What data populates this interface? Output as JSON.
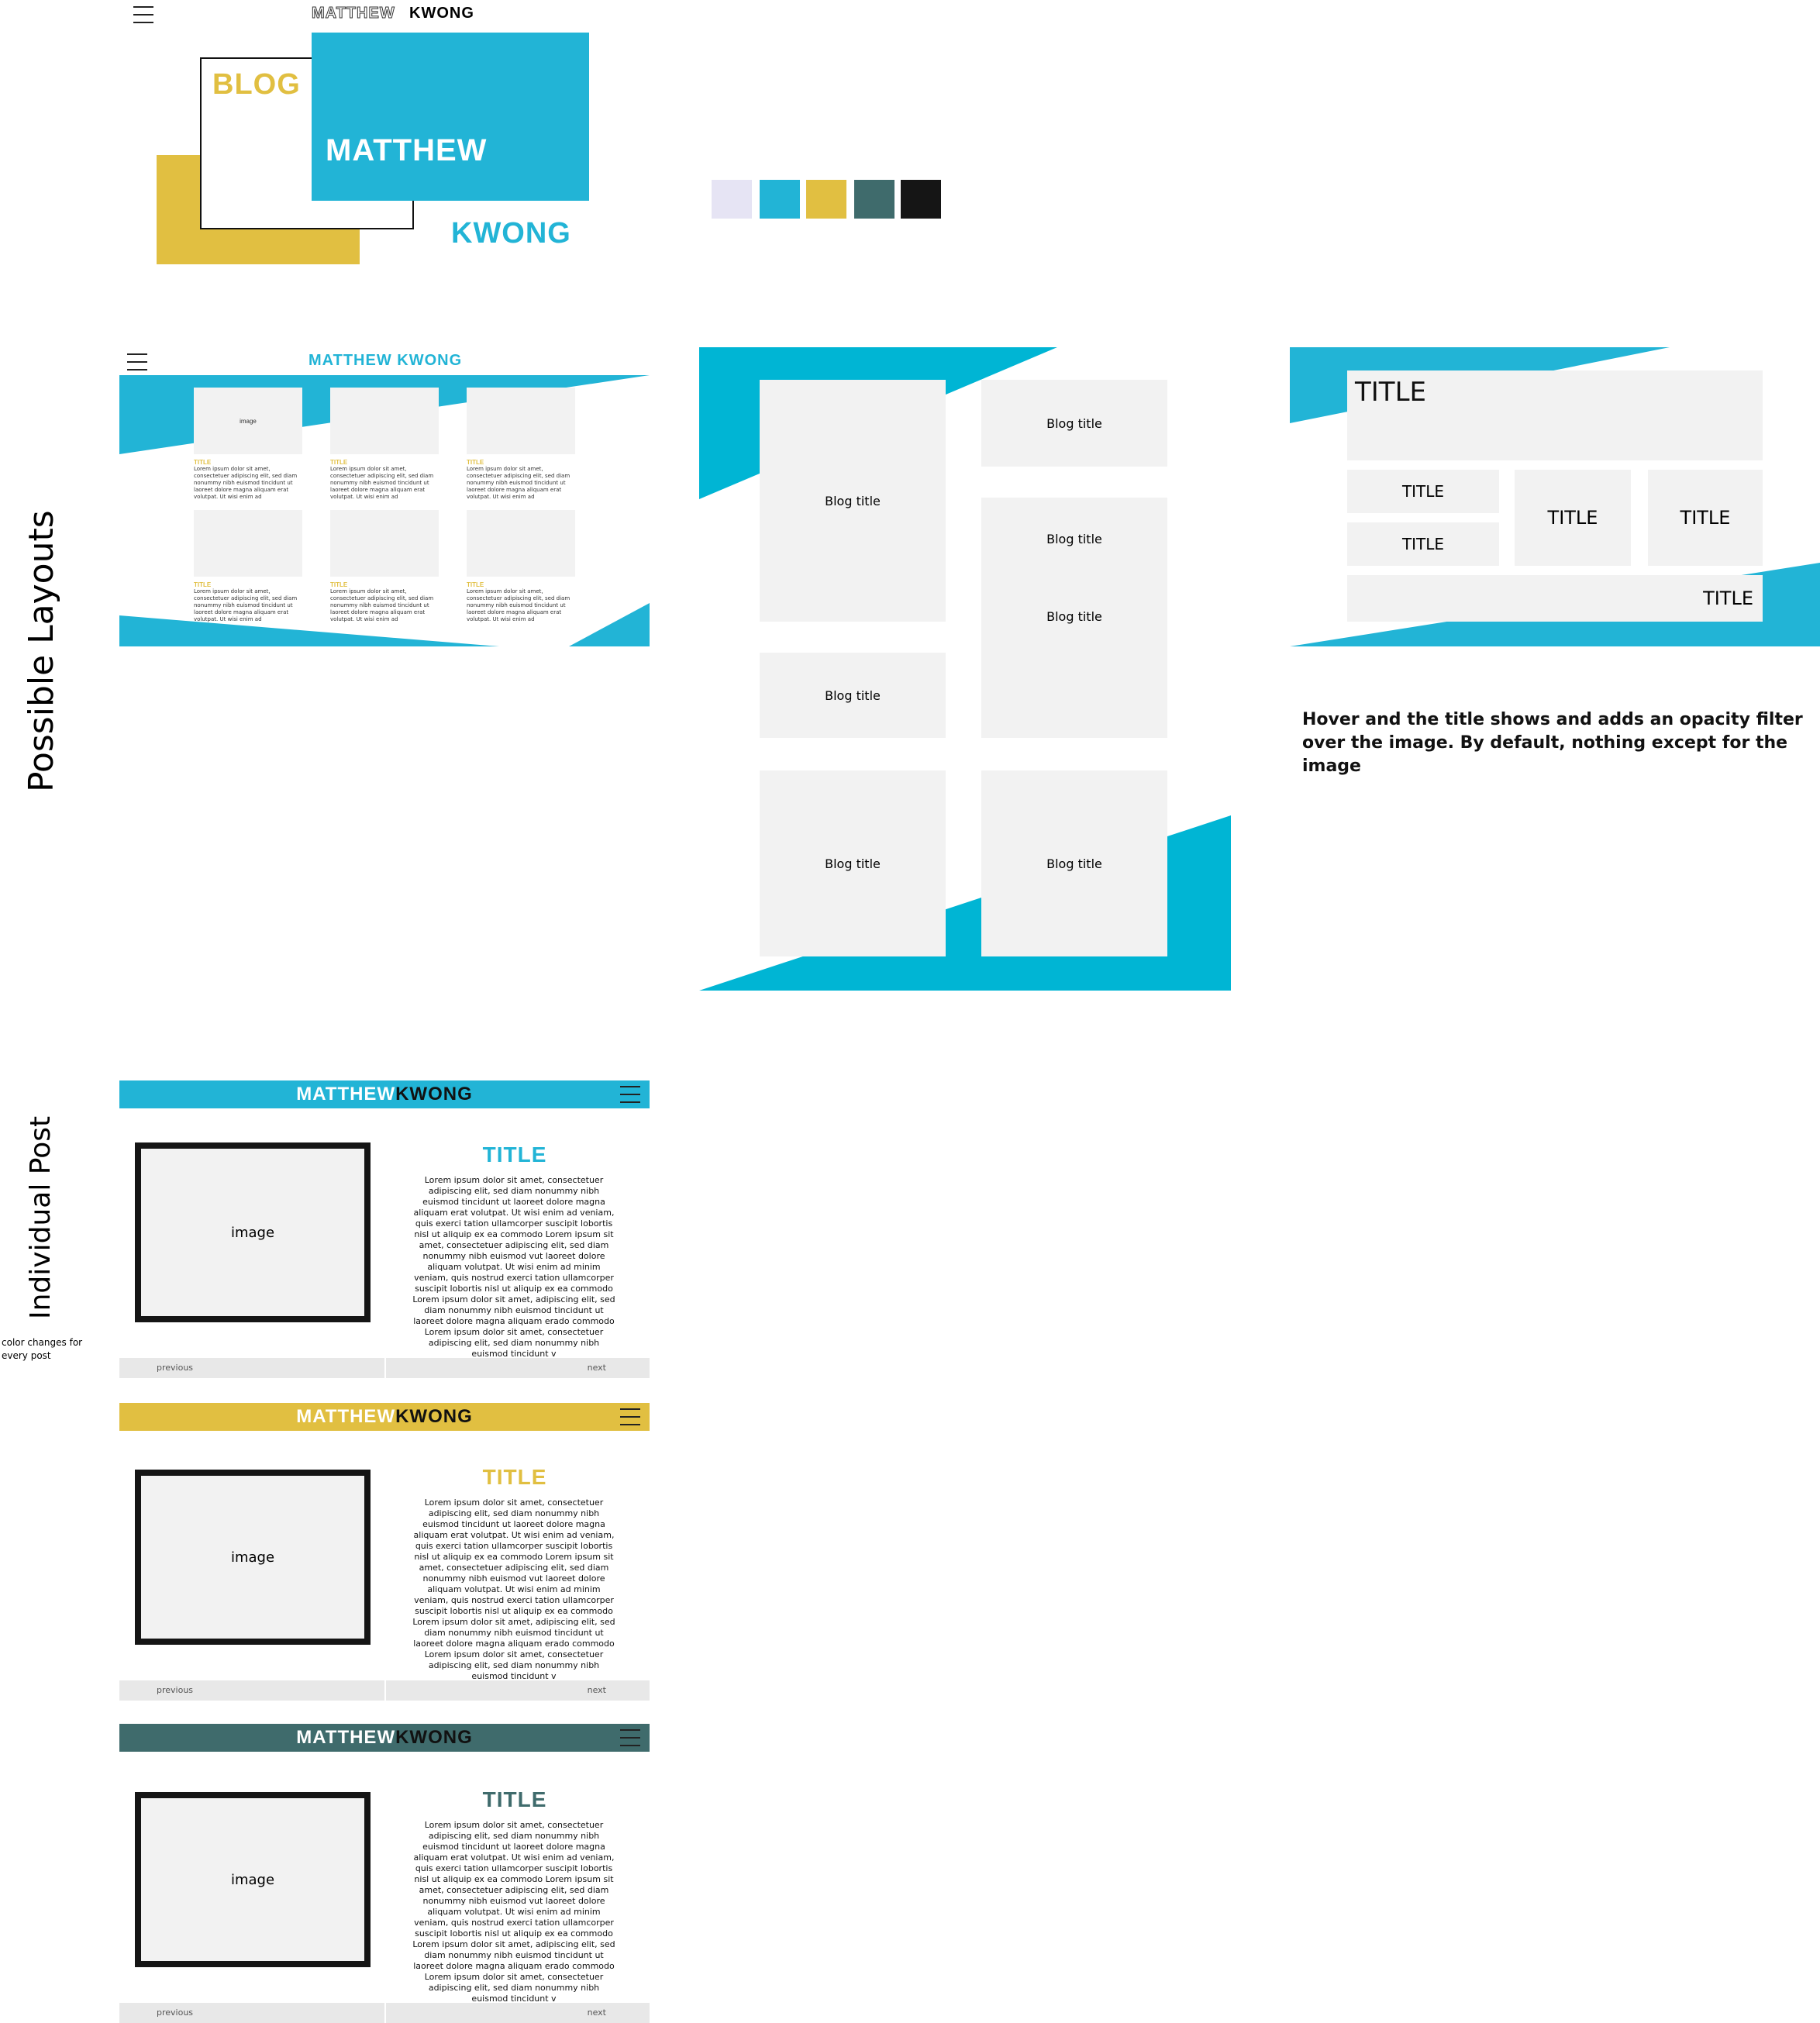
{
  "colors": {
    "lavender": "#e6e4f4",
    "cyan": "#22b4d6",
    "yellow": "#e1bf41",
    "teal": "#3f6b6c",
    "black": "#151515",
    "panel": "#f2f2f2"
  },
  "icons": {
    "menu": "hamburger-menu-icon"
  },
  "logo": {
    "header_first": "MATTHEW",
    "header_last": "KWONG",
    "blog": "BLOG",
    "first": "MATTHEW",
    "last": "KWONG"
  },
  "section_labels": {
    "layouts": "Possible Layouts",
    "post": "Individual Post",
    "color_note": "color changes for every post"
  },
  "layout1": {
    "brand": "MATTHEW KWONG",
    "image_label": "image",
    "card_title": "TITLE",
    "card_text": "Lorem ipsum dolor sit amet, consectetuer adipiscing elit, sed diam nonummy nibh euismod tincidunt ut laoreet dolore magna aliquam erat volutpat. Ut wisi enim ad"
  },
  "layout2": {
    "blog_title": "Blog title"
  },
  "layout3": {
    "big_title": "TITLE",
    "title": "TITLE",
    "note": "Hover and the title shows and adds an opacity filter over the image.  By default, nothing except for the image"
  },
  "post": {
    "first": "MATTHEW",
    "last": "KWONG",
    "title": "TITLE",
    "image_label": "image",
    "body": "Lorem ipsum dolor sit amet, consectetuer adipiscing elit, sed diam nonummy nibh euismod tincidunt ut laoreet dolore magna aliquam erat volutpat. Ut wisi enim ad veniam, quis exerci tation ullamcorper suscipit lobortis nisl ut aliquip ex ea commodo Lorem ipsum sit amet, consectetuer adipiscing elit, sed diam nonummy nibh euismod vut laoreet dolore aliquam volutpat. Ut wisi enim ad minim veniam, quis nostrud exerci tation ullamcorper suscipit lobortis nisl ut aliquip ex ea commodo Lorem ipsum dolor sit amet, adipiscing elit, sed diam nonummy nibh euismod tincidunt ut laoreet dolore magna aliquam erado commodo Lorem ipsum dolor sit amet, consectetuer adipiscing elit, sed diam nonummy nibh euismod tincidunt v",
    "previous": "previous",
    "next": "next"
  }
}
